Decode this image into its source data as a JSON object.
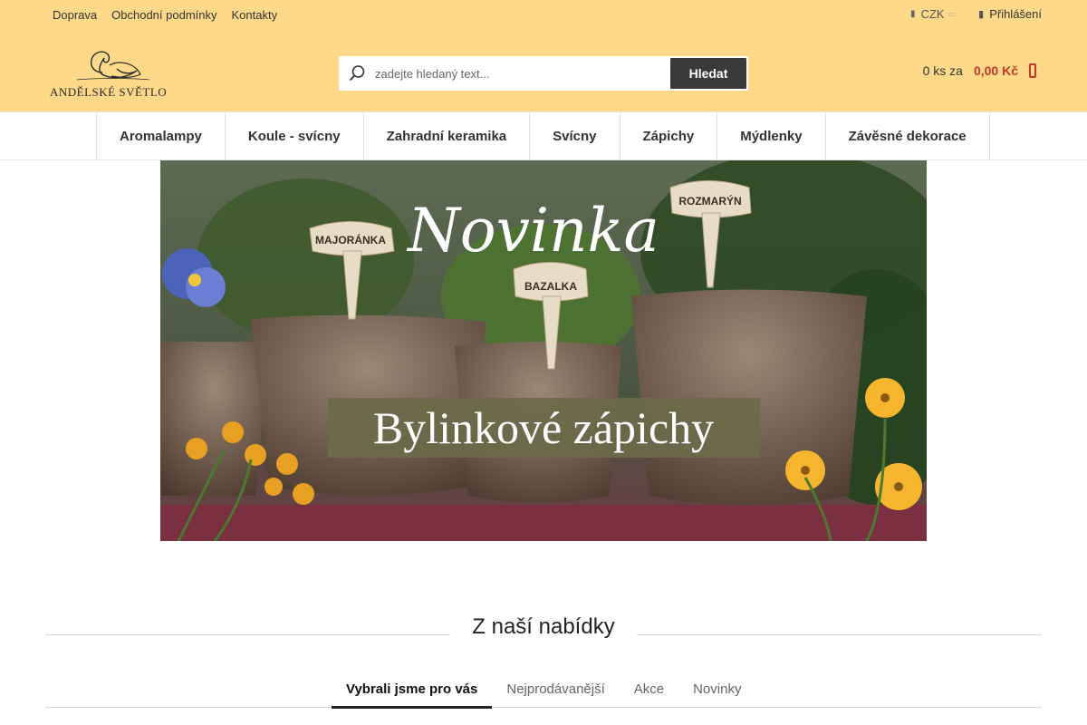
{
  "topbar": {
    "links": [
      "Doprava",
      "Obchodní podmínky",
      "Kontakty"
    ],
    "currency": "CZK",
    "login": "Přihlášení"
  },
  "logo": {
    "text": "ANDĚLSKÉ SVĚTLO"
  },
  "search": {
    "placeholder": "zadejte hledaný text...",
    "button": "Hledat"
  },
  "cart": {
    "count": "0 ks za",
    "price": "0,00 Kč"
  },
  "nav": [
    "Aromalampy",
    "Koule - svícny",
    "Zahradní keramika",
    "Svícny",
    "Zápichy",
    "Mýdlenky",
    "Závěsné dekorace"
  ],
  "banner": {
    "headline": "Novinka",
    "title": "Bylinkové zápichy",
    "labels": [
      "MAJORÁNKA",
      "BAZALKA",
      "ROZMARÝN"
    ]
  },
  "section": {
    "title": "Z naší nabídky",
    "tabs": [
      "Vybrali jsme pro vás",
      "Nejprodávanější",
      "Akce",
      "Novinky"
    ]
  },
  "colors": {
    "header_bg": "#fdd989",
    "price": "#c0392b",
    "search_button": "#3a3a3a"
  }
}
